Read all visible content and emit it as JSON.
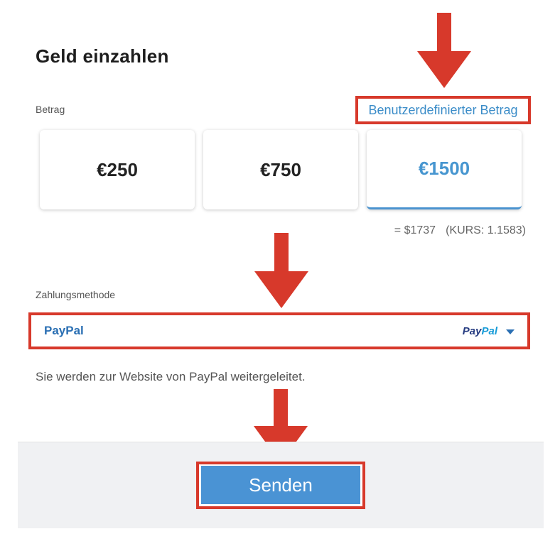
{
  "title": "Geld einzahlen",
  "amount": {
    "label": "Betrag",
    "custom_link": "Benutzerdefinierter Betrag",
    "options": [
      "€250",
      "€750",
      "€1500"
    ],
    "selected": "€1500",
    "conversion": "= $1737",
    "rate": "(KURS: 1.1583)"
  },
  "payment": {
    "label": "Zahlungsmethode",
    "selected": "PayPal",
    "logo_pay": "Pay",
    "logo_pal": "Pal",
    "chevron_icon": "chevron-down-icon",
    "note": "Sie werden zur Website von PayPal weitergeleitet."
  },
  "submit_label": "Senden",
  "colors": {
    "accent": "#4a93d4",
    "link": "#3a8cc8",
    "annotation": "#d7392b",
    "paypal_dark": "#253b80",
    "paypal_light": "#179bd7"
  }
}
